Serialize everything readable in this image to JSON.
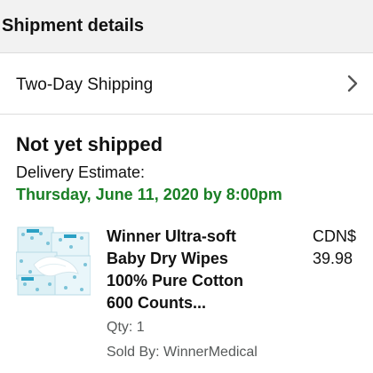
{
  "header": {
    "title": "Shipment details"
  },
  "shipping_speed": {
    "label": "Two-Day Shipping",
    "icon": "chevron-right-icon"
  },
  "shipment": {
    "status": "Not yet shipped",
    "delivery_label": "Delivery Estimate:",
    "delivery_date": "Thursday, June 11, 2020 by 8:00pm",
    "delivery_color": "#1a7f25"
  },
  "item": {
    "title_lines": [
      "Winner Ultra-soft",
      "Baby Dry Wipes",
      "100% Pure Cotton",
      "600 Counts..."
    ],
    "price_lines": [
      "CDN$",
      "39.98"
    ],
    "qty": "Qty: 1",
    "sold_by": "Sold By: WinnerMedical",
    "image": "product-image-wipes-packages"
  }
}
